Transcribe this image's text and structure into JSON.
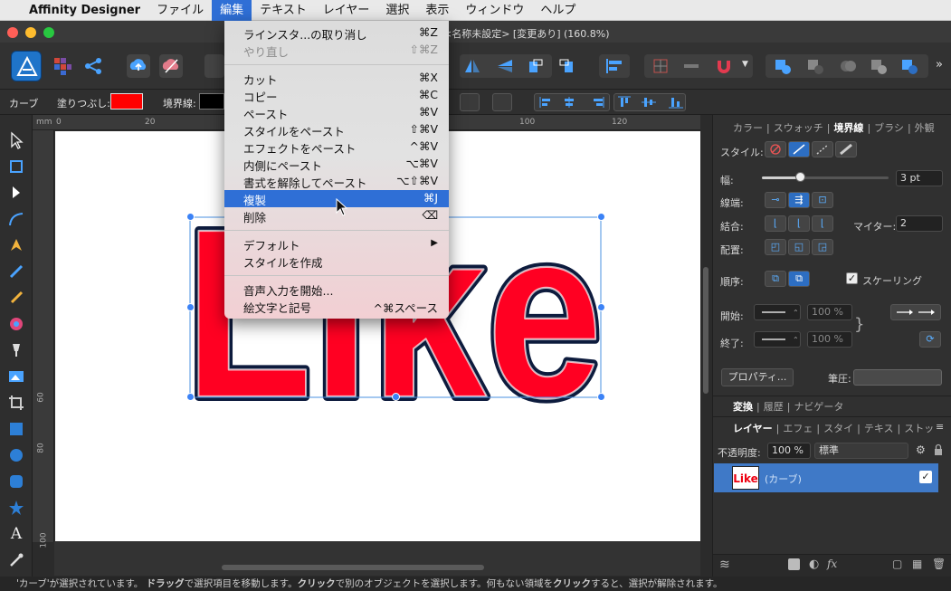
{
  "menubar": {
    "apple_icon": "",
    "app_name": "Affinity Designer",
    "items": [
      "ファイル",
      "編集",
      "テキスト",
      "レイヤー",
      "選択",
      "表示",
      "ウィンドウ",
      "ヘルプ"
    ],
    "active_item": "編集"
  },
  "window": {
    "title_suffix": "<名称未設定> [変更あり] (160.8%)"
  },
  "context_toolbar": {
    "tool_name": "カーブ",
    "fill_label": "塗りつぶし:",
    "fill_color": "#ff0000",
    "stroke_label": "境界線:",
    "stroke_color": "#000000"
  },
  "edit_menu": {
    "items": [
      {
        "label": "ラインスタ...の取り消し",
        "shortcut": "⌘Z",
        "state": "normal"
      },
      {
        "label": "やり直し",
        "shortcut": "⇧⌘Z",
        "state": "disabled"
      },
      {
        "label": "カット",
        "shortcut": "⌘X",
        "state": "normal"
      },
      {
        "label": "コピー",
        "shortcut": "⌘C",
        "state": "normal"
      },
      {
        "label": "ペースト",
        "shortcut": "⌘V",
        "state": "normal"
      },
      {
        "label": "スタイルをペースト",
        "shortcut": "⇧⌘V",
        "state": "normal"
      },
      {
        "label": "エフェクトをペースト",
        "shortcut": "^⌘V",
        "state": "normal"
      },
      {
        "label": "内側にペースト",
        "shortcut": "⌥⌘V",
        "state": "normal"
      },
      {
        "label": "書式を解除してペースト",
        "shortcut": "⌥⇧⌘V",
        "state": "normal"
      },
      {
        "label": "複製",
        "shortcut": "⌘J",
        "state": "highlighted"
      },
      {
        "label": "削除",
        "shortcut": "⌫",
        "state": "normal"
      },
      {
        "label": "デフォルト",
        "shortcut": "▶",
        "state": "normal"
      },
      {
        "label": "スタイルを作成",
        "shortcut": "",
        "state": "normal"
      },
      {
        "label": "音声入力を開始...",
        "shortcut": "",
        "state": "normal"
      },
      {
        "label": "絵文字と記号",
        "shortcut": "^⌘スペース",
        "state": "normal"
      }
    ]
  },
  "rulers": {
    "unit": "mm",
    "top_ticks": [
      "0",
      "20",
      "100",
      "120"
    ],
    "left_ticks": [
      "60",
      "80",
      "100"
    ]
  },
  "canvas": {
    "artwork_text": "Like",
    "artwork_fill": "#ff0022",
    "artwork_stroke": "#0d1b3d"
  },
  "stroke_panel": {
    "tabs": [
      "カラー",
      "スウォッチ",
      "境界線",
      "ブラシ",
      "外観"
    ],
    "active_tab": "境界線",
    "style_label": "スタイル:",
    "width_label": "幅:",
    "width_value": "3 pt",
    "width_fraction": 0.3,
    "cap_label": "線端:",
    "join_label": "結合:",
    "miter_label": "マイター:",
    "miter_value": "2",
    "align_label": "配置:",
    "order_label": "順序:",
    "scale_label": "スケーリング",
    "scale_checked": true,
    "start_label": "開始:",
    "end_label": "終了:",
    "start_pct": "100 %",
    "end_pct": "100 %",
    "properties_button": "プロパティ...",
    "pressure_label": "筆圧:"
  },
  "transform_panel": {
    "tabs": [
      "変換",
      "履歴",
      "ナビゲータ"
    ],
    "active_tab": "変換"
  },
  "layers_panel": {
    "tabs": [
      "レイヤー",
      "エフェ",
      "スタイ",
      "テキス",
      "ストッ"
    ],
    "active_tab": "レイヤー",
    "opacity_label": "不透明度:",
    "opacity_value": "100 %",
    "blend_mode": "標準",
    "layer": {
      "thumb_text": "Like",
      "name": "(カーブ)",
      "visible": true
    }
  },
  "status": {
    "segments": [
      {
        "text": "'カーブ'が選択されています。",
        "bold": false
      },
      {
        "text": "ドラッグ",
        "bold": true
      },
      {
        "text": "で選択項目を移動します。",
        "bold": false
      },
      {
        "text": "クリック",
        "bold": true
      },
      {
        "text": "で別のオブジェクトを選択します。何もない領域を",
        "bold": false
      },
      {
        "text": "クリック",
        "bold": true
      },
      {
        "text": "すると、選択が解除されます。",
        "bold": false
      }
    ]
  }
}
